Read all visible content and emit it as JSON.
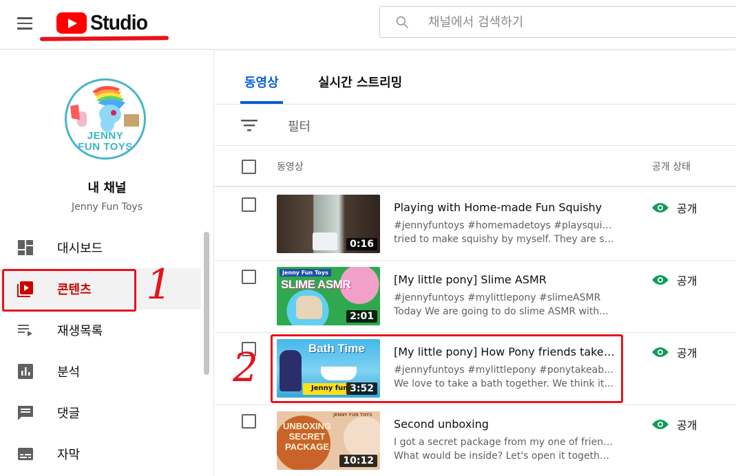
{
  "header": {
    "app_name": "Studio",
    "search_placeholder": "채널에서 검색하기",
    "icons": [
      "menu-icon",
      "youtube-logo",
      "search-icon"
    ]
  },
  "sidebar": {
    "avatar_line1": "JENNY",
    "avatar_line2": "FUN TOYS",
    "channel_title": "내 채널",
    "channel_name": "Jenny Fun Toys",
    "items": [
      {
        "label": "대시보드",
        "icon": "dashboard-icon"
      },
      {
        "label": "콘텐츠",
        "icon": "content-icon",
        "active": true
      },
      {
        "label": "재생목록",
        "icon": "playlist-icon"
      },
      {
        "label": "분석",
        "icon": "analytics-icon"
      },
      {
        "label": "댓글",
        "icon": "comments-icon"
      },
      {
        "label": "자막",
        "icon": "subtitles-icon"
      }
    ]
  },
  "annotations": {
    "first": "1",
    "second": "2",
    "color": "#e6131d"
  },
  "main": {
    "tabs": [
      {
        "label": "동영상",
        "active": true
      },
      {
        "label": "실시간 스트리밍",
        "active": false
      }
    ],
    "filter_label": "필터",
    "columns": {
      "video": "동영상",
      "visibility": "공개 상태"
    },
    "rows": [
      {
        "title": "Playing with Home-made Fun Squishy",
        "desc1": "#jennyfuntoys #homemadetoys #playsquishy I",
        "desc2": "tried to make squishy by myself. They are so...",
        "duration": "0:16",
        "visibility": "공개",
        "thumb_text": ""
      },
      {
        "title": "[My little pony] Slime ASMR",
        "desc1": "#jennyfuntoys #mylittlepony #slimeASMR",
        "desc2": "Today We are going to do slime ASMR with...",
        "duration": "2:01",
        "visibility": "공개",
        "thumb_text": "SLIME ASMR",
        "thumb_tag": "Jenny Fun Toys"
      },
      {
        "title": "[My little pony] How Pony friends take a bat...",
        "desc1": "#jennyfuntoys #mylittlepony #ponytakeabath",
        "desc2": "We love to take a bath together. We think it...",
        "duration": "3:52",
        "visibility": "공개",
        "thumb_text": "Bath Time",
        "thumb_tag": "Jenny fun"
      },
      {
        "title": "Second unboxing",
        "desc1": "I got a secret package from my one of friends.",
        "desc2": "What would be inside? Let's open it together...",
        "duration": "10:12",
        "visibility": "공개",
        "thumb_text": "UNBOXING SECRET PACKAGE",
        "thumb_tag": "JENNY FUN TOYS"
      }
    ]
  },
  "colors": {
    "accent": "#065fd4",
    "active_nav": "#cc0000",
    "public_eye": "#0f9d58",
    "youtube_red": "#ff0000"
  }
}
